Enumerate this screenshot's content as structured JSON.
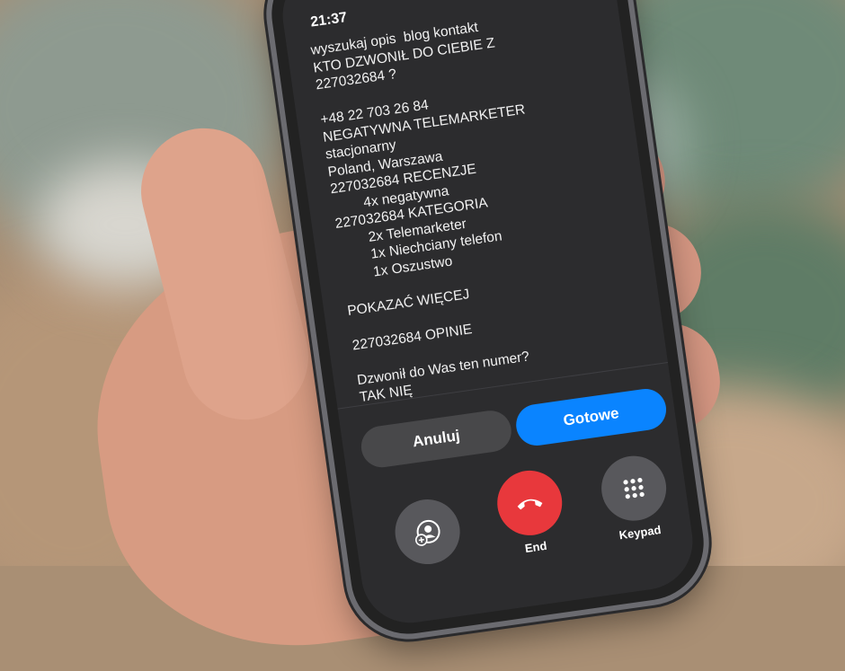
{
  "status_bar": {
    "time": "21:37"
  },
  "caller_info_lines": [
    "wyszukaj opis  blog kontakt",
    "KTO DZWONIŁ DO CIEBIE Z",
    "227032684 ?",
    "",
    "+48 22 703 26 84",
    "NEGATYWNA TELEMARKETER",
    "stacjonarny",
    "Poland, Warszawa",
    "227032684 RECENZJE",
    "        4x negatywna",
    "227032684 KATEGORIA",
    "        2x Telemarketer",
    "        1x Niechciany telefon",
    "        1x Oszustwo",
    "",
    "POKAZAĆ WIĘCEJ",
    "",
    "227032684 OPINIE",
    "",
    "Dzwonił do Was ten numer?",
    "TAK NIĘ"
  ],
  "buttons": {
    "cancel": "Anuluj",
    "done": "Gotowe"
  },
  "call_controls": {
    "contacts_label": "",
    "end_label": "End",
    "keypad_label": "Keypad"
  },
  "colors": {
    "accent": "#0a84ff",
    "end_call": "#e8383c"
  }
}
